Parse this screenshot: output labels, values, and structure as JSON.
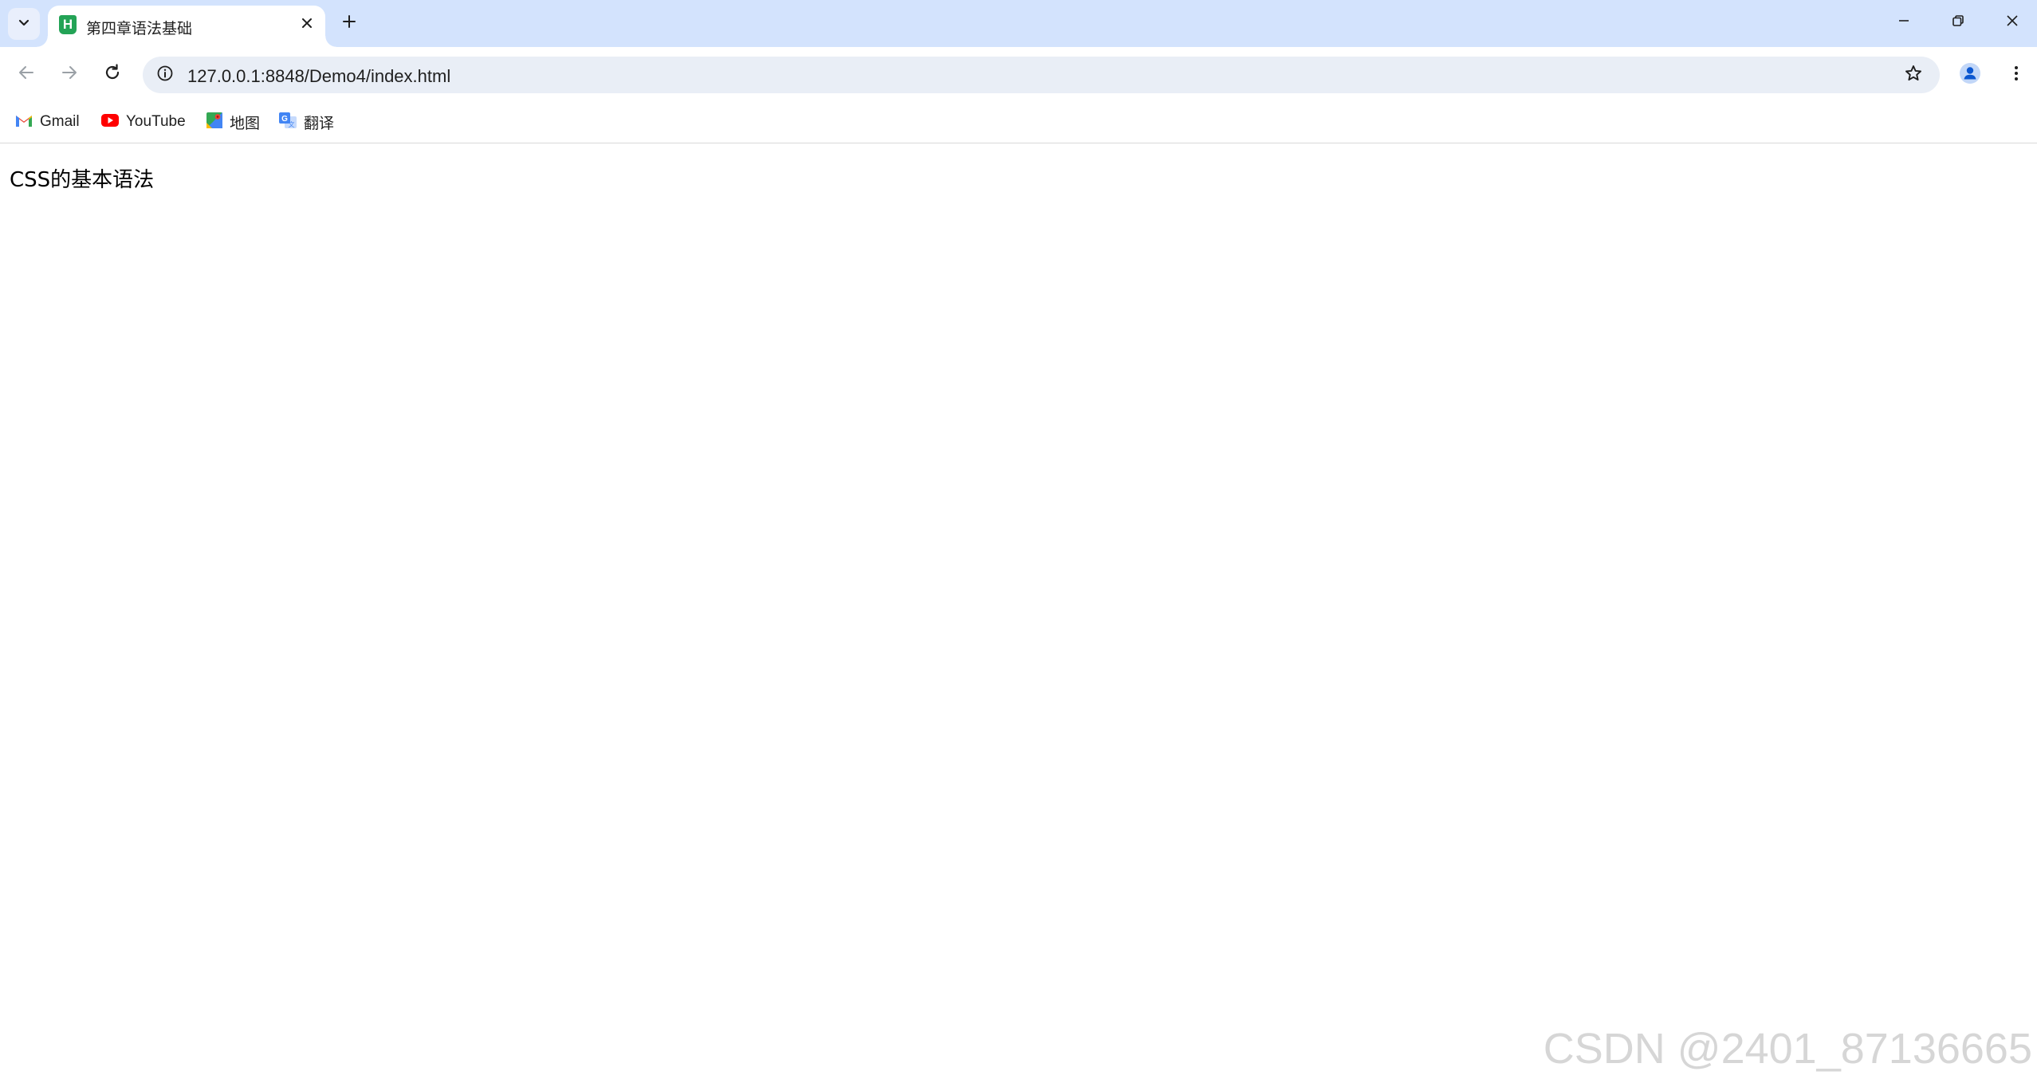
{
  "tab": {
    "title": "第四章语法基础",
    "favicon_letter": "H",
    "favicon_color": "#23a356"
  },
  "window_controls": {
    "minimize_icon": "minimize-icon",
    "restore_icon": "restore-icon",
    "close_icon": "close-icon"
  },
  "toolbar": {
    "url": "127.0.0.1:8848/Demo4/index.html"
  },
  "bookmarks": [
    {
      "label": "Gmail",
      "icon": "gmail-icon"
    },
    {
      "label": "YouTube",
      "icon": "youtube-icon"
    },
    {
      "label": "地图",
      "icon": "maps-icon"
    },
    {
      "label": "翻译",
      "icon": "translate-icon"
    }
  ],
  "page": {
    "text": "CSS的基本语法"
  },
  "watermark": "CSDN @2401_87136665",
  "colors": {
    "tabstrip_bg": "#d3e3fd",
    "omnibox_bg": "#e9eef6",
    "profile_accent": "#0b57d0"
  }
}
